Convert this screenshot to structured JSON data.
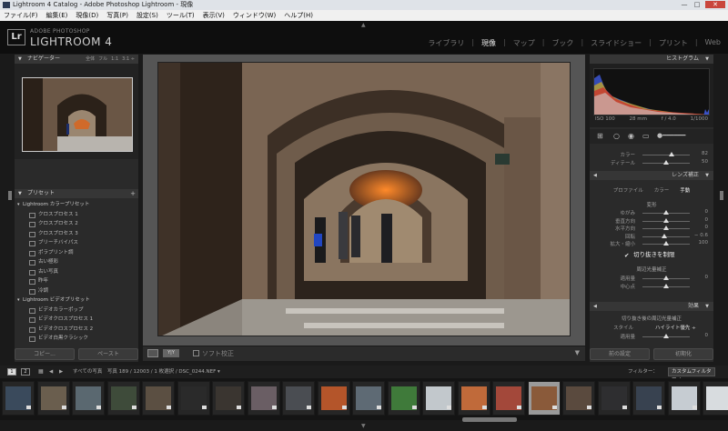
{
  "window": {
    "title": "Lightroom 4 Catalog - Adobe Photoshop Lightroom - 現像",
    "min": "—",
    "max": "□",
    "close": "✕"
  },
  "menu": [
    "ファイル(F)",
    "編集(E)",
    "現像(D)",
    "写真(P)",
    "設定(S)",
    "ツール(T)",
    "表示(V)",
    "ウィンドウ(W)",
    "ヘルプ(H)"
  ],
  "brand": {
    "logo": "Lr",
    "small": "ADOBE PHOTOSHOP",
    "big": "LIGHTROOM 4"
  },
  "modules": [
    {
      "label": "ライブラリ",
      "active": false
    },
    {
      "label": "現像",
      "active": true
    },
    {
      "label": "マップ",
      "active": false
    },
    {
      "label": "ブック",
      "active": false
    },
    {
      "label": "スライドショー",
      "active": false
    },
    {
      "label": "プリント",
      "active": false
    },
    {
      "label": "Web",
      "active": false
    }
  ],
  "navigator": {
    "title": "ナビゲーター",
    "opts": [
      "全体",
      "フル",
      "1:1",
      "3:1 ÷"
    ]
  },
  "presets": {
    "title": "プリセット",
    "plus": "+",
    "rows": [
      {
        "type": "grp",
        "label": "Lightroom カラープリセット"
      },
      {
        "type": "item",
        "label": "クロスプロセス 1"
      },
      {
        "type": "item",
        "label": "クロスプロセス 2"
      },
      {
        "type": "item",
        "label": "クロスプロセス 3"
      },
      {
        "type": "item",
        "label": "ブリーチバイパス"
      },
      {
        "type": "item",
        "label": "ポラプリント調"
      },
      {
        "type": "item",
        "label": "古い極彩"
      },
      {
        "type": "item",
        "label": "古い写真"
      },
      {
        "type": "item",
        "label": "昨年"
      },
      {
        "type": "item",
        "label": "冷調"
      },
      {
        "type": "grp",
        "label": "Lightroom ビデオプリセット"
      },
      {
        "type": "item",
        "label": "ビデオカラーポップ"
      },
      {
        "type": "item",
        "label": "ビデオクロスプロセス 1"
      },
      {
        "type": "item",
        "label": "ビデオクロスプロセス 2"
      },
      {
        "type": "item",
        "label": "ビデオ白黒クラシック"
      }
    ]
  },
  "left_buttons": {
    "copy": "コピー...",
    "paste": "ペースト"
  },
  "toolbar": {
    "yy": "Y|Y",
    "softproof": "ソフト校正"
  },
  "histogram": {
    "title": "ヒストグラム",
    "iso": "ISO 100",
    "focal": "28 mm",
    "aperture": "f / 4.0",
    "shutter": "1/1000"
  },
  "color_sliders": [
    {
      "label": "カラー",
      "value": "82",
      "pos": 0.62
    },
    {
      "label": "ディテール",
      "value": "50",
      "pos": 0.5
    }
  ],
  "lens": {
    "title": "レンズ補正",
    "tabs": [
      {
        "label": "プロファイル",
        "active": false
      },
      {
        "label": "カラー",
        "active": false
      },
      {
        "label": "手動",
        "active": true
      }
    ],
    "transform_title": "変形",
    "sliders": [
      {
        "label": "ゆがみ",
        "value": "0",
        "pos": 0.5
      },
      {
        "label": "垂直方向",
        "value": "0",
        "pos": 0.5
      },
      {
        "label": "水平方向",
        "value": "0",
        "pos": 0.5
      },
      {
        "label": "回転",
        "value": "− 0.6",
        "pos": 0.47
      },
      {
        "label": "拡大・縮小",
        "value": "100",
        "pos": 0.5
      }
    ],
    "constrain": "切り抜きを制限",
    "vignette_title": "周辺光量補正",
    "vignette_sliders": [
      {
        "label": "適用量",
        "value": "0",
        "pos": 0.5
      },
      {
        "label": "中心点",
        "value": "",
        "pos": 0.5
      }
    ]
  },
  "effects": {
    "title": "効果",
    "subtitle": "切り抜き後の周辺光量補正",
    "style_label": "スタイル",
    "style_value": "ハイライト優先 ÷",
    "amount_label": "適用量",
    "amount_value": "0"
  },
  "right_buttons": {
    "previous": "前の設定",
    "reset": "初期化"
  },
  "filmbar": {
    "page1": "1",
    "page2": "2",
    "path": "すべての写真　写真 189 / 12003 / 1 枚選択 / DSC_0244.NEF ▾",
    "filter_label": "フィルター：",
    "filter_value": "カスタムフィルター ÷"
  },
  "film_thumbs": [
    "#3a4a5c",
    "#6a5e4e",
    "#5a6870",
    "#3e4b3a",
    "#5b4f42",
    "#2a2a2a",
    "#3a3530",
    "#6a5e64",
    "#4a4d52",
    "#b4552a",
    "#5e6a74",
    "#3f7a3a",
    "#c2c8cc",
    "#c06a3a",
    "#a3483a",
    "#8a5a3a",
    "#5a4a3e",
    "#2e2e30",
    "#384250",
    "#c6ccd2",
    "#d8dcdf",
    "#e2e4e6"
  ]
}
